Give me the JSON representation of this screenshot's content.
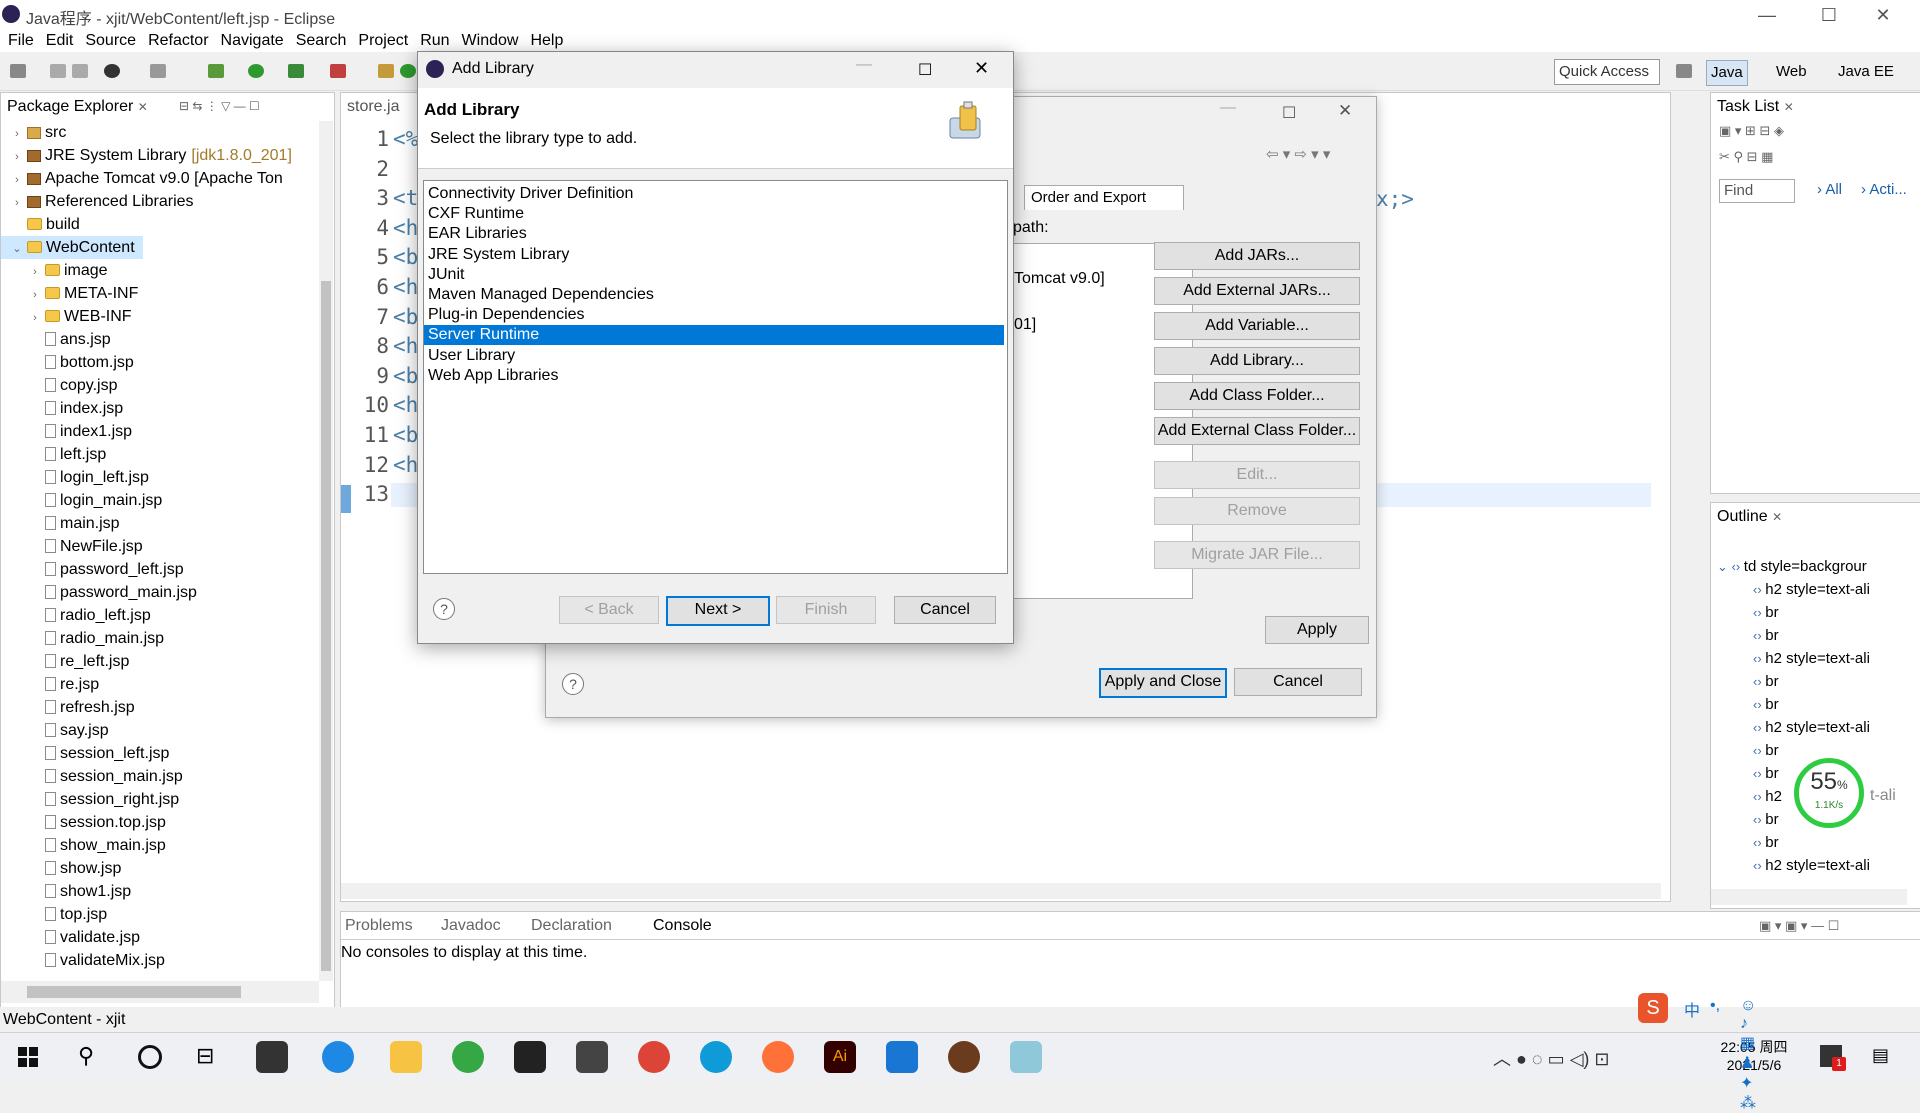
{
  "window": {
    "title": "Java程序 - xjit/WebContent/left.jsp - Eclipse",
    "controls": {
      "minimize": "—",
      "maximize": "☐",
      "close": "✕"
    }
  },
  "menu": [
    "File",
    "Edit",
    "Source",
    "Refactor",
    "Navigate",
    "Search",
    "Project",
    "Run",
    "Window",
    "Help"
  ],
  "toolbar": {
    "quick_access": "Quick Access",
    "perspectives": [
      "Java",
      "Web",
      "Java EE"
    ]
  },
  "package_explorer": {
    "tab": "Package Explorer",
    "tree": [
      {
        "label": "src",
        "icon": "src",
        "twisty": "›",
        "indent": 0
      },
      {
        "label": "JRE System Library",
        "suffix": "[jdk1.8.0_201]",
        "icon": "lib",
        "twisty": "›",
        "indent": 0
      },
      {
        "label": "Apache Tomcat v9.0 [Apache Ton",
        "icon": "lib",
        "twisty": "›",
        "indent": 0
      },
      {
        "label": "Referenced Libraries",
        "icon": "lib",
        "twisty": "›",
        "indent": 0
      },
      {
        "label": "build",
        "icon": "fold",
        "twisty": "",
        "indent": 0
      },
      {
        "label": "WebContent",
        "icon": "fold",
        "twisty": "⌄",
        "indent": 0,
        "selected": true
      },
      {
        "label": "image",
        "icon": "fold",
        "twisty": "›",
        "indent": 1
      },
      {
        "label": "META-INF",
        "icon": "fold",
        "twisty": "›",
        "indent": 1
      },
      {
        "label": "WEB-INF",
        "icon": "fold",
        "twisty": "›",
        "indent": 1
      },
      {
        "label": "ans.jsp",
        "icon": "jsp",
        "indent": 1
      },
      {
        "label": "bottom.jsp",
        "icon": "jsp",
        "indent": 1
      },
      {
        "label": "copy.jsp",
        "icon": "jsp",
        "indent": 1
      },
      {
        "label": "index.jsp",
        "icon": "jsp",
        "indent": 1
      },
      {
        "label": "index1.jsp",
        "icon": "jsp",
        "indent": 1
      },
      {
        "label": "left.jsp",
        "icon": "jsp",
        "indent": 1
      },
      {
        "label": "login_left.jsp",
        "icon": "jsp",
        "indent": 1
      },
      {
        "label": "login_main.jsp",
        "icon": "jsp",
        "indent": 1
      },
      {
        "label": "main.jsp",
        "icon": "jsp",
        "indent": 1
      },
      {
        "label": "NewFile.jsp",
        "icon": "jsp",
        "indent": 1
      },
      {
        "label": "password_left.jsp",
        "icon": "jsp",
        "indent": 1
      },
      {
        "label": "password_main.jsp",
        "icon": "jsp",
        "indent": 1
      },
      {
        "label": "radio_left.jsp",
        "icon": "jsp",
        "indent": 1
      },
      {
        "label": "radio_main.jsp",
        "icon": "jsp",
        "indent": 1
      },
      {
        "label": "re_left.jsp",
        "icon": "jsp",
        "indent": 1
      },
      {
        "label": "re.jsp",
        "icon": "jsp",
        "indent": 1
      },
      {
        "label": "refresh.jsp",
        "icon": "jsp",
        "indent": 1
      },
      {
        "label": "say.jsp",
        "icon": "jsp",
        "indent": 1
      },
      {
        "label": "session_left.jsp",
        "icon": "jsp",
        "indent": 1
      },
      {
        "label": "session_main.jsp",
        "icon": "jsp",
        "indent": 1
      },
      {
        "label": "session_right.jsp",
        "icon": "jsp",
        "indent": 1
      },
      {
        "label": "session.top.jsp",
        "icon": "jsp",
        "indent": 1
      },
      {
        "label": "show_main.jsp",
        "icon": "jsp",
        "indent": 1
      },
      {
        "label": "show.jsp",
        "icon": "jsp",
        "indent": 1
      },
      {
        "label": "show1.jsp",
        "icon": "jsp",
        "indent": 1
      },
      {
        "label": "top.jsp",
        "icon": "jsp",
        "indent": 1
      },
      {
        "label": "validate.jsp",
        "icon": "jsp",
        "indent": 1
      },
      {
        "label": "validateMix.jsp",
        "icon": "jsp",
        "indent": 1
      }
    ]
  },
  "editor": {
    "tab": "store.ja",
    "lines": [
      {
        "n": "1",
        "code": "<%"
      },
      {
        "n": "2",
        "code": ""
      },
      {
        "n": "3",
        "code": "<t"
      },
      {
        "n": "4",
        "code": "<h"
      },
      {
        "n": "5",
        "code": "<b"
      },
      {
        "n": "6",
        "code": "<h"
      },
      {
        "n": "7",
        "code": "<b"
      },
      {
        "n": "8",
        "code": "<h"
      },
      {
        "n": "9",
        "code": "<b"
      },
      {
        "n": "10",
        "code": "<h"
      },
      {
        "n": "11",
        "code": "<b"
      },
      {
        "n": "12",
        "code": "<h"
      },
      {
        "n": "13",
        "code": "</"
      }
    ],
    "tail_fragment": "x;>"
  },
  "task_list": {
    "tab": "Task List",
    "find_placeholder": "Find",
    "all": "All",
    "acti": "Acti..."
  },
  "outline": {
    "tab": "Outline",
    "items": [
      "td style=backgrour",
      "h2 style=text-ali",
      "br",
      "br",
      "h2 style=text-ali",
      "br",
      "br",
      "h2 style=text-ali",
      "br",
      "br",
      "h2",
      "br",
      "br",
      "h2 style=text-ali"
    ],
    "partial_fragment": "t-ali"
  },
  "speed_widget": {
    "percent": "55",
    "percent_sign": "%",
    "rate": "1.1K/s"
  },
  "console": {
    "tabs": [
      "Problems",
      "Javadoc",
      "Declaration",
      "Console"
    ],
    "message": "No consoles to display at this time."
  },
  "status_bar": {
    "text": "WebContent - xjit"
  },
  "properties_dialog": {
    "tab_order_export": "Order and Export",
    "path_label": "path:",
    "entries": [
      "Tomcat v9.0]",
      "01]"
    ],
    "buttons": [
      "Add JARs...",
      "Add External JARs...",
      "Add Variable...",
      "Add Library...",
      "Add Class Folder...",
      "Add External Class Folder..."
    ],
    "disabled_buttons": [
      "Edit...",
      "Remove",
      "Migrate JAR File..."
    ],
    "apply": "Apply",
    "apply_close": "Apply and Close",
    "cancel": "Cancel"
  },
  "add_library": {
    "window_title": "Add Library",
    "heading": "Add Library",
    "subtitle": "Select the library type to add.",
    "items": [
      "Connectivity Driver Definition",
      "CXF Runtime",
      "EAR Libraries",
      "JRE System Library",
      "JUnit",
      "Maven Managed Dependencies",
      "Plug-in Dependencies",
      "Server Runtime",
      "User Library",
      "Web App Libraries"
    ],
    "selected_index": 7,
    "back": "< Back",
    "next": "Next >",
    "finish": "Finish",
    "cancel": "Cancel",
    "help": "?"
  },
  "taskbar": {
    "time": "22:05 周四",
    "date": "2021/5/6",
    "ime": "中",
    "ime_punct": "•,",
    "notif_count": "1"
  },
  "colors": {
    "selection": "#0078d7",
    "accent_green": "#2ecc40",
    "code": "#4a7fa8"
  }
}
